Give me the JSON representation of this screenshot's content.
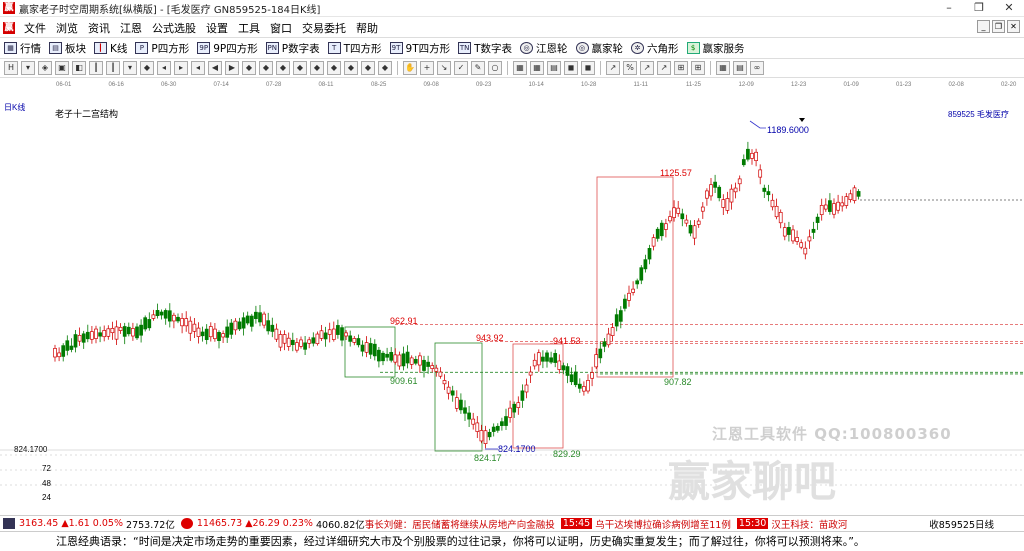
{
  "window": {
    "title": "赢家老子时空周期系统[纵横版] - [毛发医疗  GN859525-184日K线]",
    "controls": [
      "–",
      "❐",
      "✕"
    ]
  },
  "menu": [
    "文件",
    "浏览",
    "资讯",
    "江恩",
    "公式选股",
    "设置",
    "工具",
    "窗口",
    "交易委托",
    "帮助"
  ],
  "toolbar": [
    {
      "label": "行情",
      "icon": "table-icon"
    },
    {
      "label": "板块",
      "icon": "grid-icon"
    },
    {
      "label": "K线",
      "icon": "kline-icon"
    },
    {
      "label": "P四方形",
      "icon": "p-square-icon",
      "badge": "P"
    },
    {
      "label": "9P四方形",
      "icon": "9p-square-icon",
      "badge": "9P"
    },
    {
      "label": "P数字表",
      "icon": "p-number-icon",
      "badge": "PN"
    },
    {
      "label": "T四方形",
      "icon": "t-square-icon",
      "badge": "T"
    },
    {
      "label": "9T四方形",
      "icon": "9t-square-icon",
      "badge": "9T"
    },
    {
      "label": "T数字表",
      "icon": "t-number-icon",
      "badge": "TN"
    },
    {
      "label": "江恩轮",
      "icon": "wheel-icon"
    },
    {
      "label": "赢家轮",
      "icon": "wheel-icon"
    },
    {
      "label": "六角形",
      "icon": "hexagon-icon"
    },
    {
      "label": "赢家服务",
      "icon": "dollar-icon"
    }
  ],
  "chart": {
    "period_label": "日K线",
    "structure_label": "老子十二宫结构",
    "stock": "859525 毛发医疗",
    "dates": [
      "06-01",
      "06-16",
      "06-30",
      "07-14",
      "07-28",
      "08-11",
      "08-25",
      "09-08",
      "09-23",
      "10-14",
      "10-28",
      "11-11",
      "11-25",
      "12-09",
      "12-23",
      "01-09",
      "01-23",
      "02-08",
      "02-20"
    ],
    "price_labels": {
      "high": "1189.6000",
      "p1": "1125.57",
      "p2": "962.91",
      "p3": "943.92",
      "p4": "941.53",
      "p5": "909.61",
      "p6": "907.82",
      "low_mark": "824.1700",
      "low": "824.17",
      "p7": "829.29"
    },
    "axis_left_value": "824.1700",
    "volume_ticks": [
      "72",
      "48",
      "24"
    ]
  },
  "status": {
    "index1": "3163.45",
    "index1_change": "▲1.61 0.05%",
    "index1_amount": "2753.72亿",
    "index2": "11465.73",
    "index2_change": "▲26.29 0.23%",
    "index2_amount": "4060.82亿",
    "news1": "事长刘健：居民储蓄将继续从房地产向金融投",
    "news2_time": "15:45",
    "news2": "乌干达埃博拉确诊病例增至11例",
    "news3_time": "15:30",
    "news3": "汉王科技：苗政河",
    "right_label": "收859525日线"
  },
  "quote": "江恩经典语录：“时间是决定市场走势的重要因素，经过详细研究大市及个别股票的过往记录，你将可以证明，历史确实重复发生；而了解过往，你将可以预测将来。”。",
  "watermark": {
    "line1": "江恩工具软件   QQ:100800360",
    "line2": "赢家聊吧"
  },
  "chart_data": {
    "type": "candlestick",
    "title": "老子十二宫结构",
    "x": [
      "06-01",
      "06-16",
      "06-30",
      "07-14",
      "07-28",
      "08-11",
      "08-25",
      "09-08",
      "09-23",
      "10-14",
      "10-28",
      "11-11",
      "11-25",
      "12-09",
      "12-23",
      "01-09"
    ],
    "key_levels": [
      1189.6,
      1125.57,
      962.91,
      943.92,
      941.53,
      909.61,
      907.82,
      829.29,
      824.17
    ]
  }
}
